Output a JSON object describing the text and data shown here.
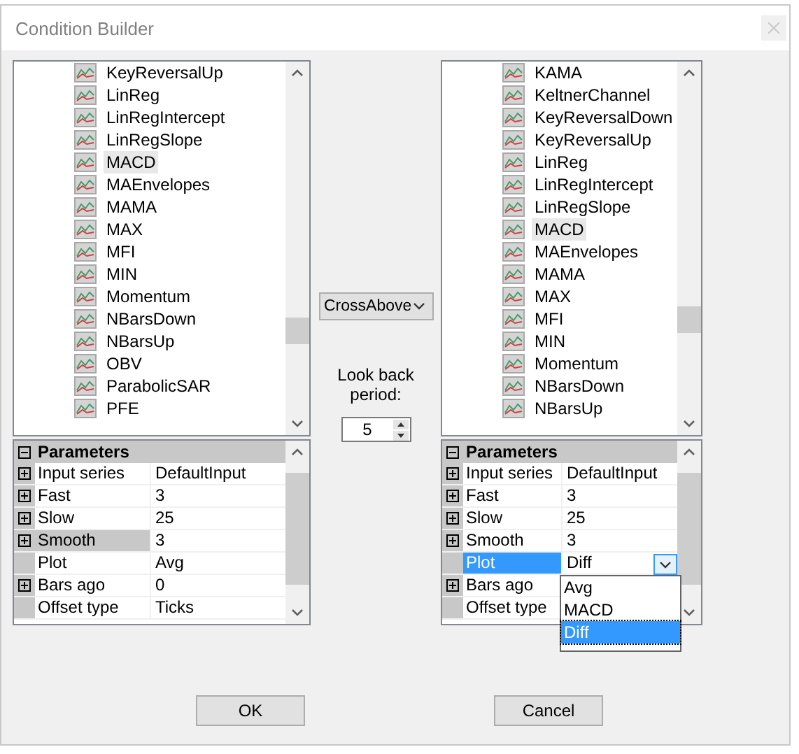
{
  "window": {
    "title": "Condition Builder"
  },
  "left_panel": {
    "indicators": [
      {
        "label": "KeyReversalUp",
        "selected": false
      },
      {
        "label": "LinReg",
        "selected": false
      },
      {
        "label": "LinRegIntercept",
        "selected": false
      },
      {
        "label": "LinRegSlope",
        "selected": false
      },
      {
        "label": "MACD",
        "selected": true
      },
      {
        "label": "MAEnvelopes",
        "selected": false
      },
      {
        "label": "MAMA",
        "selected": false
      },
      {
        "label": "MAX",
        "selected": false
      },
      {
        "label": "MFI",
        "selected": false
      },
      {
        "label": "MIN",
        "selected": false
      },
      {
        "label": "Momentum",
        "selected": false
      },
      {
        "label": "NBarsDown",
        "selected": false
      },
      {
        "label": "NBarsUp",
        "selected": false
      },
      {
        "label": "OBV",
        "selected": false
      },
      {
        "label": "ParabolicSAR",
        "selected": false
      },
      {
        "label": "PFE",
        "selected": false
      }
    ],
    "parameters": {
      "header": "Parameters",
      "rows": [
        {
          "name": "Input series",
          "value": "DefaultInput",
          "expandable": true,
          "selected": false
        },
        {
          "name": "Fast",
          "value": "3",
          "expandable": true,
          "selected": false
        },
        {
          "name": "Slow",
          "value": "25",
          "expandable": true,
          "selected": false
        },
        {
          "name": "Smooth",
          "value": "3",
          "expandable": true,
          "selected": true
        },
        {
          "name": "Plot",
          "value": "Avg",
          "expandable": false,
          "selected": false
        },
        {
          "name": "Bars ago",
          "value": "0",
          "expandable": true,
          "selected": false
        },
        {
          "name": "Offset type",
          "value": "Ticks",
          "expandable": false,
          "selected": false
        }
      ]
    }
  },
  "middle": {
    "operator": "CrossAbove",
    "lookback_label": "Look back period:",
    "lookback_value": "5"
  },
  "right_panel": {
    "indicators": [
      {
        "label": "KAMA",
        "selected": false
      },
      {
        "label": "KeltnerChannel",
        "selected": false
      },
      {
        "label": "KeyReversalDown",
        "selected": false
      },
      {
        "label": "KeyReversalUp",
        "selected": false
      },
      {
        "label": "LinReg",
        "selected": false
      },
      {
        "label": "LinRegIntercept",
        "selected": false
      },
      {
        "label": "LinRegSlope",
        "selected": false
      },
      {
        "label": "MACD",
        "selected": true
      },
      {
        "label": "MAEnvelopes",
        "selected": false
      },
      {
        "label": "MAMA",
        "selected": false
      },
      {
        "label": "MAX",
        "selected": false
      },
      {
        "label": "MFI",
        "selected": false
      },
      {
        "label": "MIN",
        "selected": false
      },
      {
        "label": "Momentum",
        "selected": false
      },
      {
        "label": "NBarsDown",
        "selected": false
      },
      {
        "label": "NBarsUp",
        "selected": false
      }
    ],
    "parameters": {
      "header": "Parameters",
      "rows": [
        {
          "name": "Input series",
          "value": "DefaultInput",
          "expandable": true,
          "selected": false
        },
        {
          "name": "Fast",
          "value": "3",
          "expandable": true,
          "selected": false
        },
        {
          "name": "Slow",
          "value": "25",
          "expandable": true,
          "selected": false
        },
        {
          "name": "Smooth",
          "value": "3",
          "expandable": true,
          "selected": false
        },
        {
          "name": "Plot",
          "value": "Diff",
          "expandable": false,
          "selected": true,
          "open": true,
          "options": [
            {
              "label": "Avg",
              "selected": false
            },
            {
              "label": "MACD",
              "selected": false
            },
            {
              "label": "Diff",
              "selected": true
            }
          ]
        },
        {
          "name": "Bars ago",
          "expandable": true,
          "selected": false
        },
        {
          "name": "Offset type",
          "expandable": false,
          "selected": false
        }
      ]
    }
  },
  "buttons": [
    {
      "label": "OK"
    },
    {
      "label": "Cancel"
    }
  ]
}
